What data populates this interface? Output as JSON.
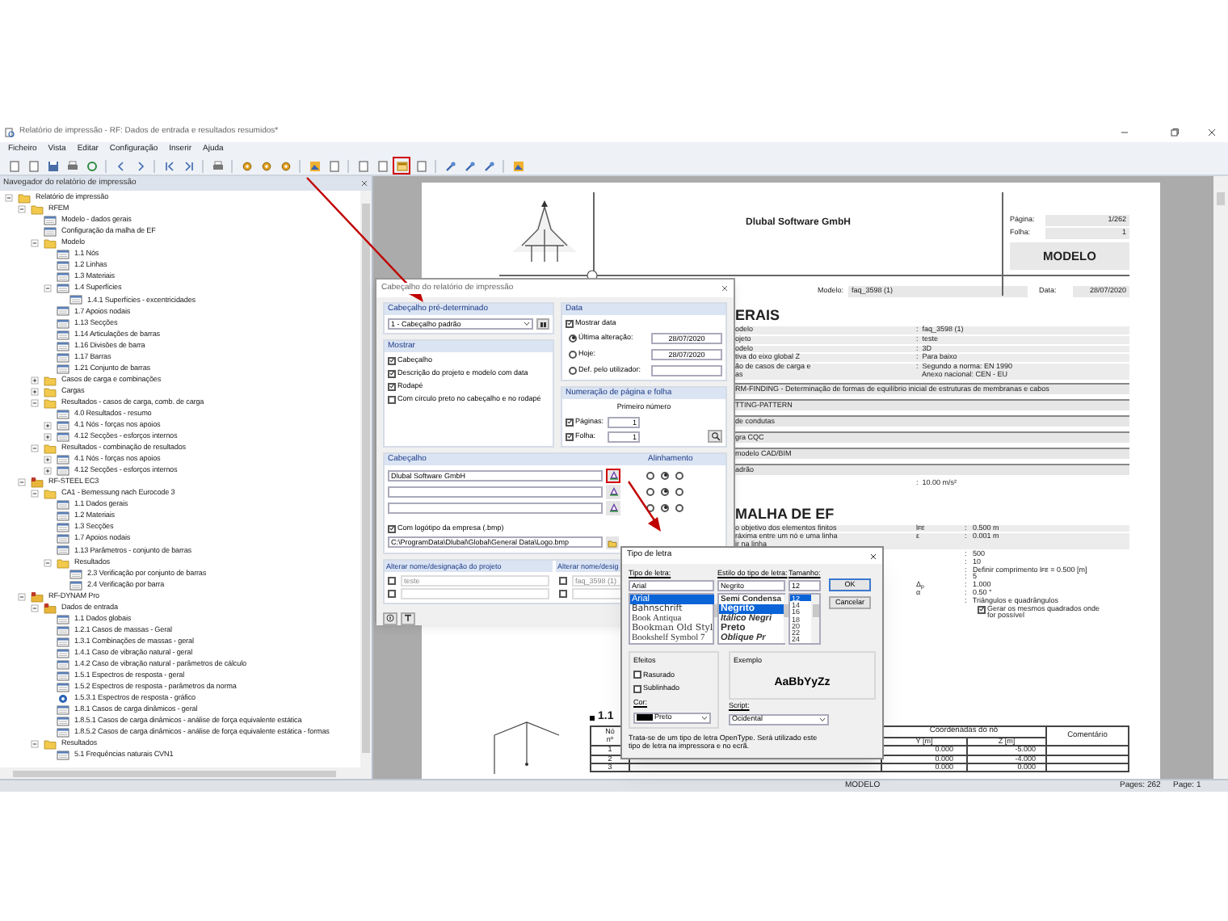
{
  "window": {
    "title": "Relatório de impressão - RF: Dados de entrada e resultados resumidos*"
  },
  "menu": [
    "Ficheiro",
    "Vista",
    "Editar",
    "Configuração",
    "Inserir",
    "Ajuda"
  ],
  "toolbar": [
    {
      "kind": "page",
      "highlighted": false
    },
    {
      "kind": "page",
      "highlighted": false
    },
    {
      "kind": "save",
      "highlighted": false
    },
    {
      "kind": "print",
      "highlighted": false
    },
    {
      "kind": "refresh",
      "highlighted": false
    },
    {
      "kind": "sep"
    },
    {
      "kind": "arrow-left",
      "highlighted": false
    },
    {
      "kind": "arrow-right",
      "highlighted": false
    },
    {
      "kind": "sep"
    },
    {
      "kind": "arrow-first",
      "highlighted": false
    },
    {
      "kind": "arrow-last",
      "highlighted": false
    },
    {
      "kind": "sep"
    },
    {
      "kind": "print",
      "highlighted": false
    },
    {
      "kind": "sep"
    },
    {
      "kind": "gear",
      "highlighted": false
    },
    {
      "kind": "gear",
      "highlighted": false
    },
    {
      "kind": "gear",
      "highlighted": false
    },
    {
      "kind": "sep"
    },
    {
      "kind": "image",
      "highlighted": false
    },
    {
      "kind": "page",
      "highlighted": false
    },
    {
      "kind": "sep"
    },
    {
      "kind": "page",
      "highlighted": false
    },
    {
      "kind": "page",
      "highlighted": false
    },
    {
      "kind": "header",
      "highlighted": true
    },
    {
      "kind": "page",
      "highlighted": false
    },
    {
      "kind": "sep"
    },
    {
      "kind": "tool",
      "highlighted": false
    },
    {
      "kind": "tool",
      "highlighted": false
    },
    {
      "kind": "tool",
      "highlighted": false
    },
    {
      "kind": "sep"
    },
    {
      "kind": "image",
      "highlighted": false
    }
  ],
  "navigator": {
    "title": "Navegador do relatório de impressão",
    "tree": [
      {
        "label": "Relatório de impressão",
        "kind": "folder",
        "expanded": true,
        "children": [
          {
            "label": "RFEM",
            "kind": "folder",
            "expanded": true,
            "children": [
              {
                "label": "Modelo - dados gerais",
                "kind": "page"
              },
              {
                "label": "Configuração da malha de EF",
                "kind": "page"
              },
              {
                "label": "Modelo",
                "kind": "folder",
                "expanded": true,
                "children": [
                  {
                    "label": "1.1 Nós",
                    "kind": "page"
                  },
                  {
                    "label": "1.2 Linhas",
                    "kind": "page"
                  },
                  {
                    "label": "1.3 Materiais",
                    "kind": "page"
                  },
                  {
                    "label": "1.4 Superfícies",
                    "kind": "page",
                    "expanded": true,
                    "children": [
                      {
                        "label": "1.4.1 Superfícies - excentricidades",
                        "kind": "page"
                      }
                    ]
                  },
                  {
                    "label": "1.7 Apoios nodais",
                    "kind": "page"
                  },
                  {
                    "label": "1.13 Secções",
                    "kind": "page"
                  },
                  {
                    "label": "1.14 Articulações de barras",
                    "kind": "page"
                  },
                  {
                    "label": "1.16 Divisões de barra",
                    "kind": "page"
                  },
                  {
                    "label": "1.17 Barras",
                    "kind": "page"
                  },
                  {
                    "label": "1.21 Conjunto de barras",
                    "kind": "page"
                  }
                ]
              },
              {
                "label": "Casos de carga e combinações",
                "kind": "folder",
                "expanded": false
              },
              {
                "label": "Cargas",
                "kind": "folder",
                "expanded": false
              },
              {
                "label": "Resultados - casos de carga, comb. de carga",
                "kind": "folder",
                "expanded": true,
                "children": [
                  {
                    "label": "4.0 Resultados - resumo",
                    "kind": "page"
                  },
                  {
                    "label": "4.1 Nós - forças nos apoios",
                    "kind": "page",
                    "expanded": false
                  },
                  {
                    "label": "4.12 Secções - esforços internos",
                    "kind": "page",
                    "expanded": false
                  }
                ]
              },
              {
                "label": "Resultados - combinação de resultados",
                "kind": "folder",
                "expanded": true,
                "children": [
                  {
                    "label": "4.1 Nós - forças nos apoios",
                    "kind": "page",
                    "expanded": false
                  },
                  {
                    "label": "4.12 Secções - esforços internos",
                    "kind": "page",
                    "expanded": false
                  }
                ]
              }
            ]
          },
          {
            "label": "RF-STEEL EC3",
            "kind": "module",
            "expanded": true,
            "children": [
              {
                "label": "CA1 - Bemessung nach Eurocode 3",
                "kind": "folder",
                "expanded": true,
                "children": [
                  {
                    "label": "1.1 Dados gerais",
                    "kind": "page"
                  },
                  {
                    "label": "1.2 Materiais",
                    "kind": "page"
                  },
                  {
                    "label": "1.3 Secções",
                    "kind": "page"
                  },
                  {
                    "label": "1.7 Apoios nodais",
                    "kind": "page"
                  },
                  {
                    "label": "1.13 Parâmetros - conjunto de barras",
                    "kind": "page"
                  },
                  {
                    "label": "Resultados",
                    "kind": "folder",
                    "expanded": true,
                    "children": [
                      {
                        "label": "2.3 Verificação por conjunto de barras",
                        "kind": "page"
                      },
                      {
                        "label": "2.4 Verificação por barra",
                        "kind": "page"
                      }
                    ]
                  }
                ]
              }
            ]
          },
          {
            "label": "RF-DYNAM Pro",
            "kind": "module",
            "expanded": true,
            "children": [
              {
                "label": "Dados de entrada",
                "kind": "module",
                "expanded": true,
                "children": [
                  {
                    "label": "1.1 Dados globais",
                    "kind": "page"
                  },
                  {
                    "label": "1.2.1 Casos de massas - Geral",
                    "kind": "page"
                  },
                  {
                    "label": "1.3.1 Combinações de massas - geral",
                    "kind": "page"
                  },
                  {
                    "label": "1.4.1 Caso de vibração natural - geral",
                    "kind": "page"
                  },
                  {
                    "label": "1.4.2 Caso de vibração natural - parâmetros de cálculo",
                    "kind": "page"
                  },
                  {
                    "label": "1.5.1 Espectros de resposta - geral",
                    "kind": "page"
                  },
                  {
                    "label": "1.5.2 Espectros de resposta - parâmetros da norma",
                    "kind": "page"
                  },
                  {
                    "label": "1.5.3.1 Espectros de resposta - gráfico",
                    "kind": "graphic"
                  },
                  {
                    "label": "1.8.1 Casos de carga dinâmicos - geral",
                    "kind": "page"
                  },
                  {
                    "label": "1.8.5.1 Casos de carga dinâmicos - análise de força equivalente estática",
                    "kind": "page"
                  },
                  {
                    "label": "1.8.5.2 Casos de carga dinâmicos - análise de força equivalente estática - formas",
                    "kind": "page"
                  }
                ]
              },
              {
                "label": "Resultados",
                "kind": "folder",
                "expanded": true,
                "children": [
                  {
                    "label": "5.1 Frequências naturais CVN1",
                    "kind": "page"
                  }
                ]
              }
            ]
          }
        ]
      }
    ]
  },
  "document": {
    "company": "Dlubal Software GmbH",
    "page_label": "Página:",
    "page_value": "1/262",
    "sheet_label": "Folha:",
    "sheet_value": "1",
    "title_box": "MODELO",
    "model_label": "Modelo:",
    "model_value": "faq_3598 (1)",
    "date_label": "Data:",
    "date_value": "28/07/2020",
    "sections": [
      {
        "heading": "ERAIS",
        "kind": "general",
        "rows": [
          {
            "label": "odelo",
            "value": ":  faq_3598 (1)"
          },
          {
            "label": "ojeto",
            "value": ":  teste"
          },
          {
            "label": "odelo",
            "value": ":  3D"
          },
          {
            "label": "tiva do eixo global Z",
            "value": ":  Para baixo"
          },
          {
            "label": "ão de casos de carga e\nas",
            "value": ":  Segundo a norma: EN 1990\n   Anexo nacional: CEN - EU"
          },
          {
            "label": "RM-FINDING - Determinação de formas de equilíbrio inicial de estruturas de membranas e cabos",
            "kind": "option"
          },
          {
            "label": "TTING-PATTERN",
            "kind": "option"
          },
          {
            "label": "de condutas",
            "kind": "option"
          },
          {
            "label": "gra CQC",
            "kind": "option"
          },
          {
            "label": "modelo CAD/BIM",
            "kind": "option"
          },
          {
            "label": "adrão",
            "kind": "option"
          },
          {
            "value": ":  10.00 m/s²"
          }
        ]
      },
      {
        "heading": "MALHA DE EF",
        "kind": "mesh",
        "rows": [
          {
            "label": "o objetivo dos elementos finitos",
            "symbol": "l$_{FE}$",
            "value": ":   0.500 m"
          },
          {
            "label": "ráxima entre um nó e uma linha\nir na linha",
            "symbol": "ε",
            "value": ":   0.001 m"
          },
          {
            "value": ":   500"
          },
          {
            "value": ":   10"
          },
          {
            "value": ":   Definir comprimento l$_{FE}$ = 0.500 [m]"
          },
          {
            "value": ":   5"
          },
          {
            "symbol": "Δ$_{p}$",
            "value": ":   1.000"
          },
          {
            "symbol": "α",
            "value": ":   0.50 °"
          },
          {
            "value": ":   Triângulos e quadrângulos"
          },
          {
            "value": "Gerar os mesmos quadrados onde\nfor possível",
            "kind": "checkbox",
            "checked": true
          }
        ]
      }
    ],
    "table": {
      "heading": "1.1",
      "columns": [
        "Nó\nnº",
        "Y [m]",
        "Z [m]",
        "Comentário"
      ],
      "group_header": "Coordenadas do nó",
      "rows": [
        [
          "1",
          "0.000",
          "-5.000"
        ],
        [
          "2",
          "0.000",
          "-4.000"
        ],
        [
          "3",
          "0.000",
          "0.000"
        ]
      ]
    }
  },
  "header_dialog": {
    "title": "Cabeçalho do relatório de impressão",
    "preset": {
      "heading": "Cabeçalho pré-determinado",
      "value": "1 - Cabeçalho padrão"
    },
    "show": {
      "heading": "Mostrar",
      "items": [
        {
          "label": "Cabeçalho",
          "checked": true
        },
        {
          "label": "Descrição do projeto e modelo com data",
          "checked": true
        },
        {
          "label": "Rodapé",
          "checked": true
        },
        {
          "label": "Com círculo preto no cabeçalho e no rodapé",
          "checked": false
        }
      ]
    },
    "date": {
      "heading": "Data",
      "show_label": "Mostrar data",
      "show_checked": true,
      "options": [
        {
          "label": "Última alteração:",
          "selected": true,
          "value": "28/07/2020"
        },
        {
          "label": "Hoje:",
          "selected": false,
          "value": "28/07/2020"
        },
        {
          "label": "Def. pelo utilizador:",
          "selected": false
        }
      ]
    },
    "numbering": {
      "heading": "Numeração de página e folha",
      "subheading": "Primeiro número",
      "items": [
        {
          "label": "Páginas:",
          "checked": true,
          "value": "1"
        },
        {
          "label": "Folha:",
          "checked": true,
          "value": "1"
        }
      ]
    },
    "header_lines": {
      "heading": "Cabeçalho",
      "align_heading": "Alinhamento",
      "lines": [
        {
          "value": "Dlubal Software GmbH",
          "highlighted": true,
          "align": [
            {
              "selected": false
            },
            {
              "selected": true
            },
            {
              "selected": false
            }
          ]
        },
        {
          "highlighted": false,
          "align": [
            {
              "selected": false
            },
            {
              "selected": true
            },
            {
              "selected": false
            }
          ]
        },
        {
          "highlighted": false,
          "align": [
            {
              "selected": false
            },
            {
              "selected": true
            },
            {
              "selected": false
            }
          ]
        }
      ]
    },
    "logo": {
      "label": "Com logótipo da empresa (.bmp)",
      "checked": true,
      "path": "C:\\ProgramData\\Dlubal\\Global\\General Data\\Logo.bmp"
    },
    "rename": [
      {
        "heading": "Alterar nome/designação do projeto",
        "rows": [
          {
            "checked": false,
            "disabled": true,
            "value": "teste"
          },
          {
            "checked": false,
            "disabled": true
          }
        ]
      },
      {
        "heading": "Alterar nome/desig",
        "rows": [
          {
            "checked": false,
            "disabled": true,
            "value": "faq_3598 (1)"
          },
          {
            "checked": false,
            "disabled": true
          }
        ]
      }
    ]
  },
  "font_dialog": {
    "title": "Tipo de letra",
    "font_label": "Tipo de letra:",
    "font_value": "Arial",
    "fonts": [
      {
        "label": "Arial",
        "selected": true
      },
      {
        "label": "Bahnschrift",
        "selected": false
      },
      {
        "label": "Book Antiqua",
        "selected": false
      },
      {
        "label": "Bookman Old Styl",
        "selected": false
      },
      {
        "label": "Bookshelf Symbol 7",
        "selected": false
      }
    ],
    "style_label": "Estilo do tipo de letra:",
    "style_value": "Negrito",
    "styles": [
      {
        "label": "Semi Condensa",
        "selected": false
      },
      {
        "label": "Negrito",
        "selected": true
      },
      {
        "label": "Itálico Negri",
        "selected": false
      },
      {
        "label": "Preto",
        "selected": false
      },
      {
        "label": "Oblique Pr",
        "selected": false
      }
    ],
    "size_label": "Tamanho:",
    "size_value": "12",
    "sizes": [
      {
        "label": "12",
        "selected": true
      },
      {
        "label": "14",
        "selected": false
      },
      {
        "label": "16",
        "selected": false
      },
      {
        "label": "18",
        "selected": false
      },
      {
        "label": "20",
        "selected": false
      },
      {
        "label": "22",
        "selected": false
      },
      {
        "label": "24",
        "selected": false
      }
    ],
    "ok": "OK",
    "cancel": "Cancelar",
    "effects_heading": "Efeitos",
    "effects": [
      {
        "label": "Rasurado",
        "checked": false
      },
      {
        "label": "Sublinhado",
        "checked": false
      }
    ],
    "color_label": "Cor:",
    "color_value": "Preto",
    "color": "#000000",
    "sample_heading": "Exemplo",
    "sample": "AaBbYyZz",
    "script_label": "Script:",
    "script_value": "Ocidental",
    "note": "Trata-se de um tipo de letra OpenType. Será utilizado este tipo de letra na impressora e no ecrã."
  },
  "status_bar": {
    "model": "MODELO",
    "pages": "Pages: 262",
    "page": "Page: 1"
  }
}
